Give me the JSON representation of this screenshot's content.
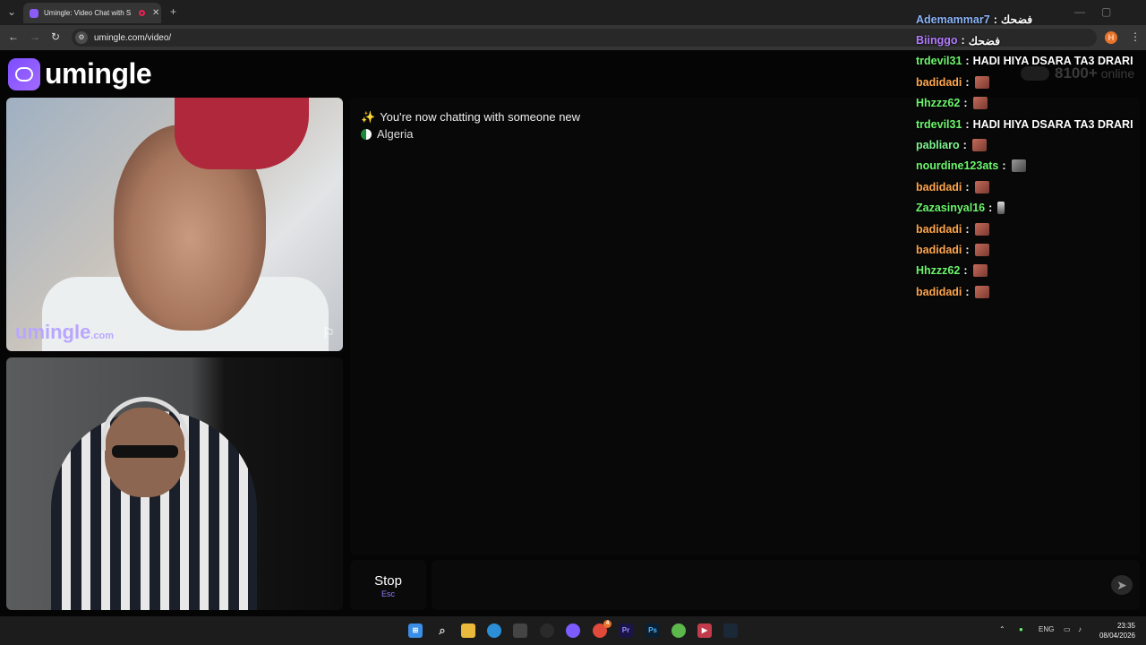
{
  "browser": {
    "tab_title": "Umingle: Video Chat with S",
    "tab_close": "✕",
    "new_tab": "+",
    "url": "umingle.com/video/",
    "profile_initial": "H",
    "back": "←",
    "forward": "→",
    "reload": "↻",
    "star": "☆",
    "menu": "⋮"
  },
  "site": {
    "logo_text": "umingle",
    "watermark_main": "umingle",
    "watermark_suffix": ".com"
  },
  "chat": {
    "status_message": "You're now chatting with someone new",
    "country": "Algeria",
    "stop_label": "Stop",
    "stop_key": "Esc"
  },
  "online": {
    "count": "8100+",
    "label": "online"
  },
  "stream_chat": [
    {
      "user": "Ademammar7",
      "text": "فضحك",
      "color": "#8ab4f8",
      "emote": null
    },
    {
      "user": "Biinggo",
      "text": "فضحك",
      "color": "#b47cff",
      "emote": null
    },
    {
      "user": "trdevil31",
      "text": "HADI HIYA DSARA TA3 DRARI",
      "color": "#6cf56c",
      "emote": null
    },
    {
      "user": "badidadi",
      "text": "",
      "color": "#ffa64d",
      "emote": "red"
    },
    {
      "user": "Hhzzz62",
      "text": "",
      "color": "#6cf56c",
      "emote": "red"
    },
    {
      "user": "trdevil31",
      "text": "HADI HIYA DSARA TA3 DRARI",
      "color": "#6cf56c",
      "emote": null
    },
    {
      "user": "pabliaro",
      "text": "",
      "color": "#7ff58f",
      "emote": "red"
    },
    {
      "user": "nourdine123ats",
      "text": "",
      "color": "#6cf56c",
      "emote": "grey"
    },
    {
      "user": "badidadi",
      "text": "",
      "color": "#ffa64d",
      "emote": "red"
    },
    {
      "user": "Zazasinyal16",
      "text": "",
      "color": "#6cf56c",
      "emote": "small"
    },
    {
      "user": "badidadi",
      "text": "",
      "color": "#ffa64d",
      "emote": "red"
    },
    {
      "user": "badidadi",
      "text": "",
      "color": "#ffa64d",
      "emote": "red"
    },
    {
      "user": "Hhzzz62",
      "text": "",
      "color": "#6cf56c",
      "emote": "red"
    },
    {
      "user": "badidadi",
      "text": "",
      "color": "#ffa64d",
      "emote": "red"
    }
  ],
  "taskbar": {
    "language": "ENG",
    "time": "23:35",
    "date": "08/04/2026",
    "badge_count": "4"
  }
}
